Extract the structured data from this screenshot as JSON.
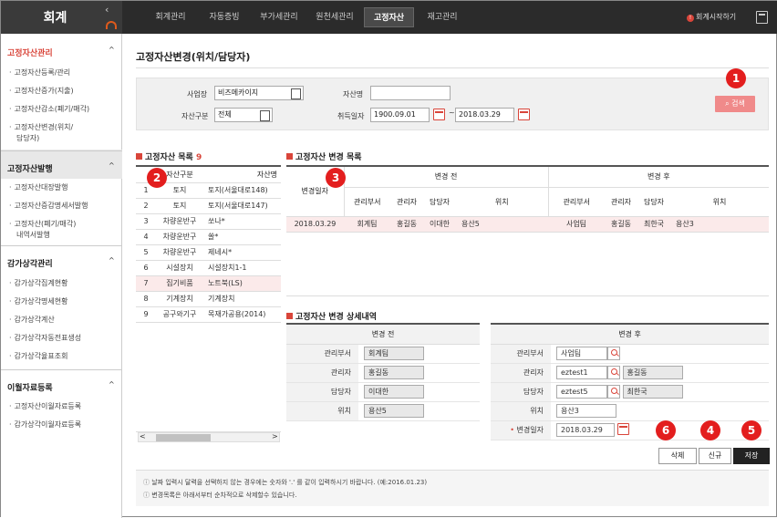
{
  "app": {
    "title": "회계",
    "collapse_icon": "chevron-left-icon"
  },
  "nav": {
    "items": [
      "회계관리",
      "자동증빙",
      "부가세관리",
      "원천세관리",
      "고정자산",
      "재고관리"
    ],
    "active": "고정자산",
    "start_label": "회계시작하기",
    "start_dot": "!"
  },
  "sidebar": {
    "sections": [
      {
        "title": "고정자산관리",
        "items": [
          "고정자산등록/관리",
          "고정자산증가(지출)",
          "고정자산감소(폐기/매각)",
          "고정자산변경(위치/",
          "담당자)"
        ]
      },
      {
        "title": "고정자산발행",
        "items": [
          "고정자산대장발행",
          "고정자산증감명세서발행",
          "고정자산(폐기/매각)",
          "내역서발행"
        ]
      },
      {
        "title": "감가상각관리",
        "items": [
          "감가상각집계현황",
          "감가상각명세현황",
          "감가상각계산",
          "감가상각자동전표생성",
          "감가상각율표조회"
        ]
      },
      {
        "title": "이월자료등록",
        "items": [
          "고정자산이월자료등록",
          "감가상각이월자료등록"
        ]
      }
    ],
    "chevron": "^"
  },
  "page": {
    "title": "고정자산변경(위치/담당자)"
  },
  "filter": {
    "business_label": "사업장",
    "business_value": "비즈메카이지",
    "asset_type_label": "자산구분",
    "asset_type_value": "전체",
    "asset_name_label": "자산명",
    "asset_name_value": "",
    "acq_date_label": "취득일자",
    "date_from": "1900.09.01",
    "date_sep": "~",
    "date_to": "2018.03.29",
    "search_label": "검색",
    "search_icon": "search-icon"
  },
  "badges": [
    "1",
    "2",
    "3",
    "4",
    "5",
    "6"
  ],
  "asset_list": {
    "title": "고정자산 목록",
    "count": "9",
    "headers": [
      "",
      "자산구분",
      "자산명"
    ],
    "rows": [
      [
        "1",
        "토지",
        "토지(서울대로148)"
      ],
      [
        "2",
        "토지",
        "토지(서울대로147)"
      ],
      [
        "3",
        "차량운반구",
        "쏘나*"
      ],
      [
        "4",
        "차량운반구",
        "쏠*"
      ],
      [
        "5",
        "차량운반구",
        "제네시*"
      ],
      [
        "6",
        "시설장치",
        "시설장치1-1"
      ],
      [
        "7",
        "집기비품",
        "노트북(LS)"
      ],
      [
        "8",
        "기계장치",
        "기계장치"
      ],
      [
        "9",
        "공구와기구",
        "목재가공용(2014)"
      ]
    ],
    "scroll_left": "<",
    "scroll_right": ">"
  },
  "change_list": {
    "title": "고정자산 변경 목록",
    "date_header": "변경일자",
    "before_header": "변경 전",
    "after_header": "변경 후",
    "sub_headers": [
      "관리부서",
      "관리자",
      "담당자",
      "위치"
    ],
    "rows": [
      {
        "date": "2018.03.29",
        "before": [
          "회계팀",
          "홍길동",
          "이대한",
          "용산5"
        ],
        "after": [
          "사업팀",
          "홍길동",
          "최한국",
          "용산3"
        ]
      }
    ]
  },
  "detail": {
    "title": "고정자산 변경 상세내역",
    "before_header": "변경 전",
    "after_header": "변경 후",
    "labels": [
      "관리부서",
      "관리자",
      "담당자",
      "위치"
    ],
    "before_values": [
      "회계팀",
      "홍길동",
      "이대한",
      "용산5"
    ],
    "after": {
      "dept": "사업팀",
      "manager_id": "eztest1",
      "manager_name": "홍길동",
      "person_id": "eztest5",
      "person_name": "최한국",
      "location": "용산3",
      "change_date_label": "변경일자",
      "required_mark": "•",
      "change_date": "2018.03.29"
    }
  },
  "buttons": {
    "delete": "삭제",
    "new": "신규",
    "save": "저장"
  },
  "notes": [
    "날짜 입력시 달력을 선택하지 않는 경우에는 숫자와 '.' 를 같이 입력하시기 바랍니다. (예:2016.01.23)",
    "변경목록은 아래서부터 순차적으로 삭제할수 있습니다."
  ],
  "colors": {
    "accent": "#d9453a",
    "badge": "#e31e1e",
    "topbar": "#2b2b2b",
    "search_button": "#f08a8a"
  }
}
